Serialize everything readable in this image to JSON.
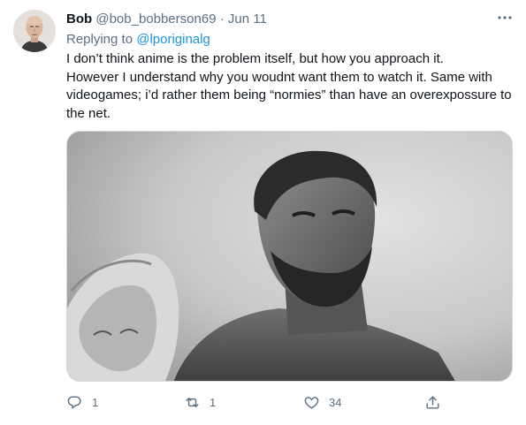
{
  "tweet": {
    "author_name": "Bob",
    "author_handle": "@bob_bobberson69",
    "separator": "·",
    "date": "Jun 11",
    "reply_prefix": "Replying to ",
    "reply_mention": "@lporiginalg",
    "text_lines": [
      "I don’t think anime is the problem itself, but how you approach it.",
      "However I understand why you woudnt want them to watch it. Same with",
      "videogames; i’d rather them being “normies” than have an overexpossure to",
      "the net."
    ],
    "media_description_icon": "photo"
  },
  "actions": {
    "reply_icon": "speech-bubble-icon",
    "reply_count": "1",
    "retweet_icon": "retweet-icon",
    "retweet_count": "1",
    "like_icon": "heart-icon",
    "like_count": "34",
    "share_icon": "share-icon"
  },
  "colors": {
    "text": "#0f1419",
    "secondary": "#5b7083",
    "link": "#1b95e0",
    "border": "#cfd9de"
  }
}
